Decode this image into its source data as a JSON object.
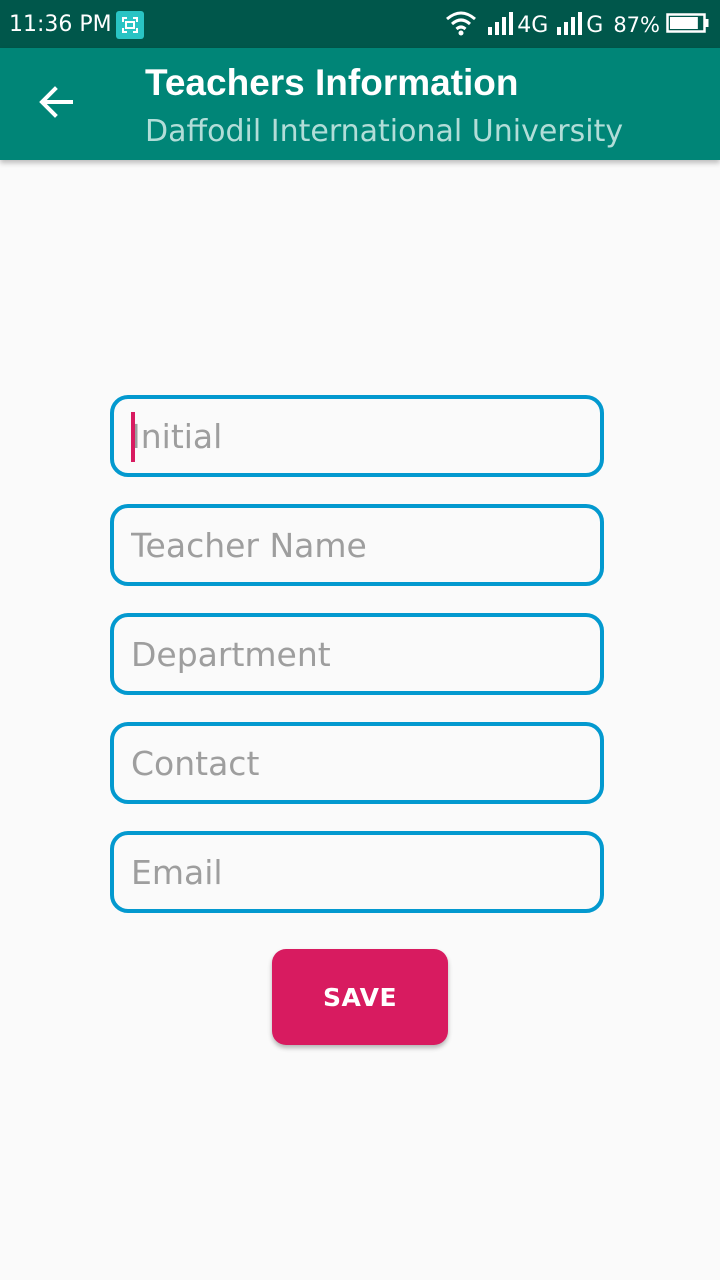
{
  "status_bar": {
    "time": "11:36 PM",
    "network_1": "4G",
    "network_2": "G",
    "battery": "87%",
    "battery_level": 0.87,
    "icons": [
      "screenshot-icon",
      "wifi-icon",
      "signal-icon",
      "signal-icon",
      "battery-icon"
    ]
  },
  "app_bar": {
    "title": "Teachers Information",
    "subtitle": "Daffodil International University",
    "back_icon": "arrow-back-icon"
  },
  "form": {
    "initial": {
      "placeholder": "Initial",
      "value": ""
    },
    "teacher_name": {
      "placeholder": "Teacher Name",
      "value": ""
    },
    "department": {
      "placeholder": "Department",
      "value": ""
    },
    "contact": {
      "placeholder": "Contact",
      "value": ""
    },
    "email": {
      "placeholder": "Email",
      "value": ""
    },
    "save_label": "SAVE"
  },
  "colors": {
    "status_bar": "#00574b",
    "app_bar": "#008577",
    "field_border": "#0399cf",
    "accent": "#d81b60",
    "background": "#fafafa"
  }
}
